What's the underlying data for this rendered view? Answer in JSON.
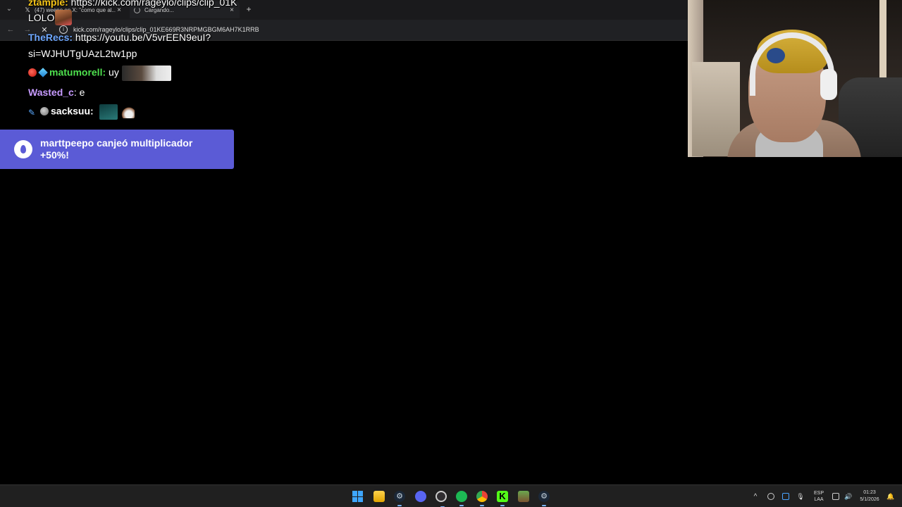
{
  "browser": {
    "tabs": [
      {
        "favicon": "x-logo-icon",
        "title": "(47) weeno en X: \"como que al...",
        "close": "×"
      },
      {
        "favicon": "loading-spinner-icon",
        "title": "Cargando...",
        "close": "×"
      }
    ],
    "new_tab": "+",
    "url": "kick.com/rageylo/clips/clip_01KE669R3NRPMGBGM6AH7K1RRB"
  },
  "chat": {
    "lines": [
      {
        "user": "ztample",
        "user_color": "#f5c518",
        "sep": ":",
        "text": " https://kick.com/rageylo/clips/clip_01K"
      },
      {
        "text": "LOLO"
      },
      {
        "user": "TheRecs",
        "user_color": "#6fa8ff",
        "sep": ":",
        "text": " https://youtu.be/V5vrEEN9euI?"
      },
      {
        "text": "si=WJHUTgUAzL2tw1pp"
      },
      {
        "user": "matumorell",
        "user_color": "#4ee14e",
        "sep": ":",
        "text": " uy",
        "badges": [
          "red-badge-icon",
          "cube-badge-icon"
        ]
      },
      {
        "user": "Wasted_c",
        "user_color": "#c79bff",
        "sep": ":",
        "text": " e"
      },
      {
        "user": "sacksuu",
        "user_color": "#ffffff",
        "sep": ":",
        "badges": [
          "sword-badge-icon",
          "gray-badge-icon"
        ]
      }
    ]
  },
  "redemption": {
    "icon": "flame-icon",
    "text": "marttpeepo canjeó multiplicador +50%!"
  },
  "taskbar": {
    "apps": [
      "windows-start-icon",
      "file-explorer-icon",
      "steam-icon",
      "discord-icon",
      "obs-icon",
      "spotify-icon",
      "chrome-icon",
      "kick-icon",
      "minecraft-icon",
      "steam-icon"
    ],
    "tray": {
      "chevron": "^",
      "lang_top": "ESP",
      "lang_bottom": "LAA",
      "time": "01:23",
      "date": "5/1/2026"
    }
  },
  "colors": {
    "redemption_bg": "#5b5bd6",
    "kick_green": "#53fc18"
  }
}
